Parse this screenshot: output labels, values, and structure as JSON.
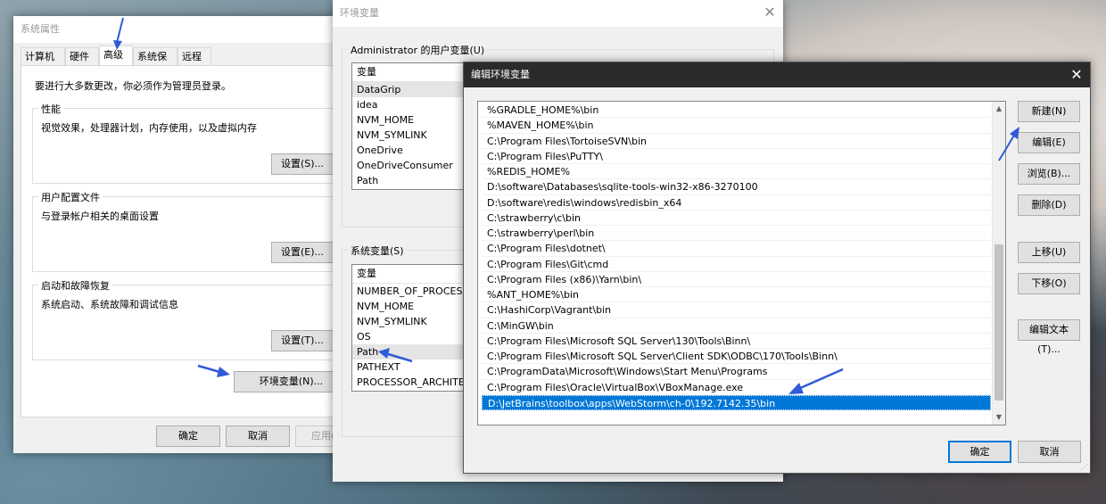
{
  "sysprops": {
    "title": "系统属性",
    "tabs": [
      "计算机名",
      "硬件",
      "高级",
      "系统保护",
      "远程"
    ],
    "admin_note": "要进行大多数更改，你必须作为管理员登录。",
    "performance": {
      "title": "性能",
      "desc": "视觉效果，处理器计划，内存使用，以及虚拟内存",
      "button": "设置(S)..."
    },
    "profiles": {
      "title": "用户配置文件",
      "desc": "与登录帐户相关的桌面设置",
      "button": "设置(E)..."
    },
    "startup": {
      "title": "启动和故障恢复",
      "desc": "系统启动、系统故障和调试信息",
      "button": "设置(T)..."
    },
    "env_button": "环境变量(N)...",
    "ok": "确定",
    "cancel": "取消",
    "apply": "应用("
  },
  "envvars": {
    "title": "环境变量",
    "user_group": "Administrator 的用户变量(U)",
    "user_header": "变量",
    "user_vars": [
      "DataGrip",
      "idea",
      "NVM_HOME",
      "NVM_SYMLINK",
      "OneDrive",
      "OneDriveConsumer",
      "Path"
    ],
    "sys_group": "系统变量(S)",
    "sys_header": "变量",
    "sys_vars": [
      "NUMBER_OF_PROCESSO",
      "NVM_HOME",
      "NVM_SYMLINK",
      "OS",
      "Path",
      "PATHEXT",
      "PROCESSOR_ARCHITECT"
    ]
  },
  "editor": {
    "title": "编辑环境变量",
    "paths": [
      "%GRADLE_HOME%\\bin",
      "%MAVEN_HOME%\\bin",
      "C:\\Program Files\\TortoiseSVN\\bin",
      "C:\\Program Files\\PuTTY\\",
      "%REDIS_HOME%",
      "D:\\software\\Databases\\sqlite-tools-win32-x86-3270100",
      "D:\\software\\redis\\windows\\redisbin_x64",
      "C:\\strawberry\\c\\bin",
      "C:\\strawberry\\perl\\bin",
      "C:\\Program Files\\dotnet\\",
      "C:\\Program Files\\Git\\cmd",
      "C:\\Program Files (x86)\\Yarn\\bin\\",
      "%ANT_HOME%\\bin",
      "C:\\HashiCorp\\Vagrant\\bin",
      "C:\\MinGW\\bin",
      "C:\\Program Files\\Microsoft SQL Server\\130\\Tools\\Binn\\",
      "C:\\Program Files\\Microsoft SQL Server\\Client SDK\\ODBC\\170\\Tools\\Binn\\",
      "C:\\ProgramData\\Microsoft\\Windows\\Start Menu\\Programs",
      "C:\\Program Files\\Oracle\\VirtualBox\\VBoxManage.exe",
      "D:\\JetBrains\\toolbox\\apps\\WebStorm\\ch-0\\192.7142.35\\bin"
    ],
    "buttons": {
      "new": "新建(N)",
      "edit": "编辑(E)",
      "browse": "浏览(B)...",
      "delete": "删除(D)",
      "up": "上移(U)",
      "down": "下移(O)",
      "edit_text": "编辑文本(T)..."
    },
    "ok": "确定",
    "cancel": "取消"
  },
  "colors": {
    "selection": "#0078d7",
    "annotation_arrow": "#2f5bd7"
  }
}
